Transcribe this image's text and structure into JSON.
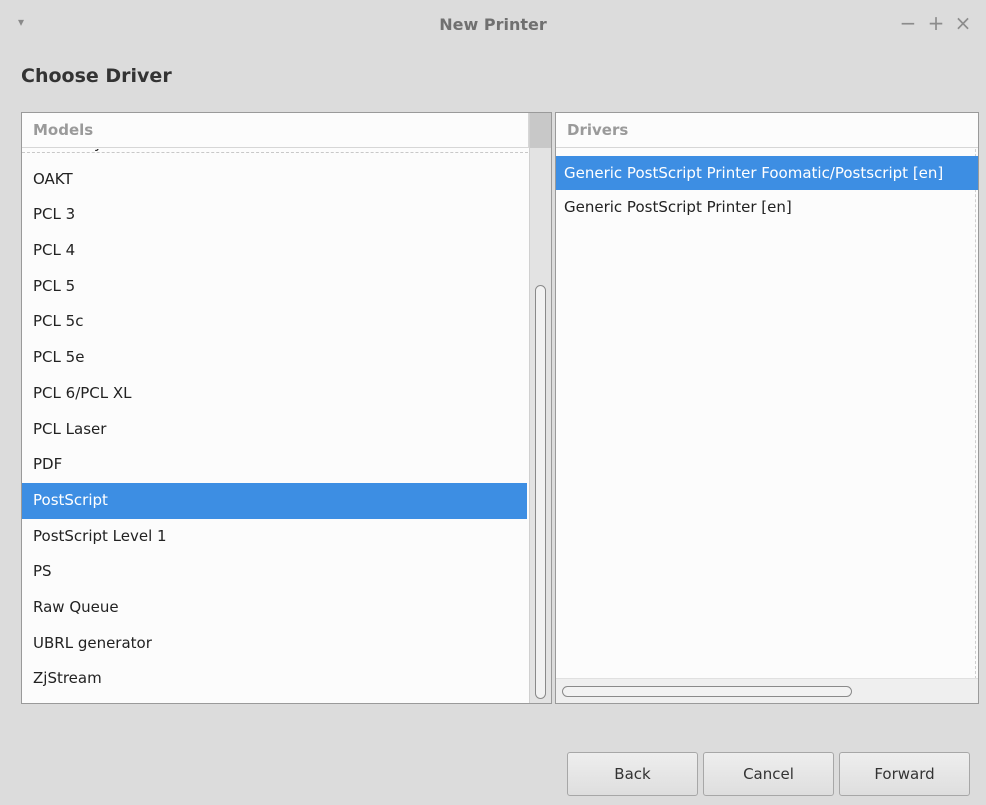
{
  "window": {
    "title": "New Printer",
    "controls": {
      "menu": "▾",
      "minimize": "−",
      "maximize": "+",
      "close": "×"
    }
  },
  "heading": "Choose Driver",
  "models": {
    "header": "Models",
    "items": [
      "IPP Everywhere",
      "OAKT",
      "PCL 3",
      "PCL 4",
      "PCL 5",
      "PCL 5c",
      "PCL 5e",
      "PCL 6/PCL XL",
      "PCL Laser",
      "PDF",
      "PostScript",
      "PostScript Level 1",
      "PS",
      "Raw Queue",
      "UBRL generator",
      "ZjStream"
    ],
    "selected": "PostScript"
  },
  "drivers": {
    "header": "Drivers",
    "items": [
      "Generic PostScript Printer Foomatic/Postscript [en]",
      "Generic PostScript Printer [en]"
    ],
    "selected": "Generic PostScript Printer Foomatic/Postscript [en]"
  },
  "buttons": {
    "back": "Back",
    "cancel": "Cancel",
    "forward": "Forward"
  },
  "colors": {
    "selection": "#3d8ee3",
    "window_bg": "#dcdcdc"
  }
}
